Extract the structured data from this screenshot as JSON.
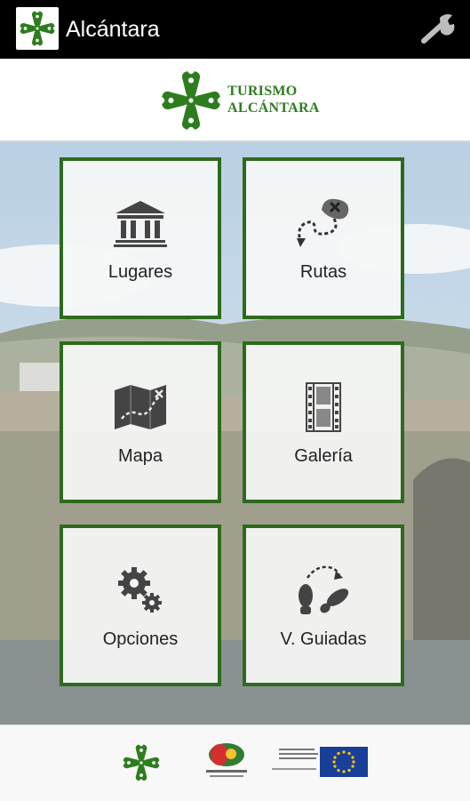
{
  "actionbar": {
    "title": "Alcántara",
    "settings_icon": "wrench-icon"
  },
  "brand": {
    "line1": "TURISMO",
    "line2": "ALCÁNTARA",
    "color": "#2d7d1e"
  },
  "colors": {
    "tile_border": "#2d6b1c",
    "actionbar_bg": "#000000"
  },
  "menu": [
    {
      "label": "Lugares",
      "icon": "monument-icon"
    },
    {
      "label": "Rutas",
      "icon": "route-icon"
    },
    {
      "label": "Mapa",
      "icon": "map-icon"
    },
    {
      "label": "Galería",
      "icon": "film-icon"
    },
    {
      "label": "Opciones",
      "icon": "gears-icon"
    },
    {
      "label": "V. Guiadas",
      "icon": "footsteps-icon"
    }
  ],
  "footer": {
    "logos": [
      "alcantara-cross-logo",
      "cooperation-logo",
      "eu-flag-logo"
    ]
  }
}
